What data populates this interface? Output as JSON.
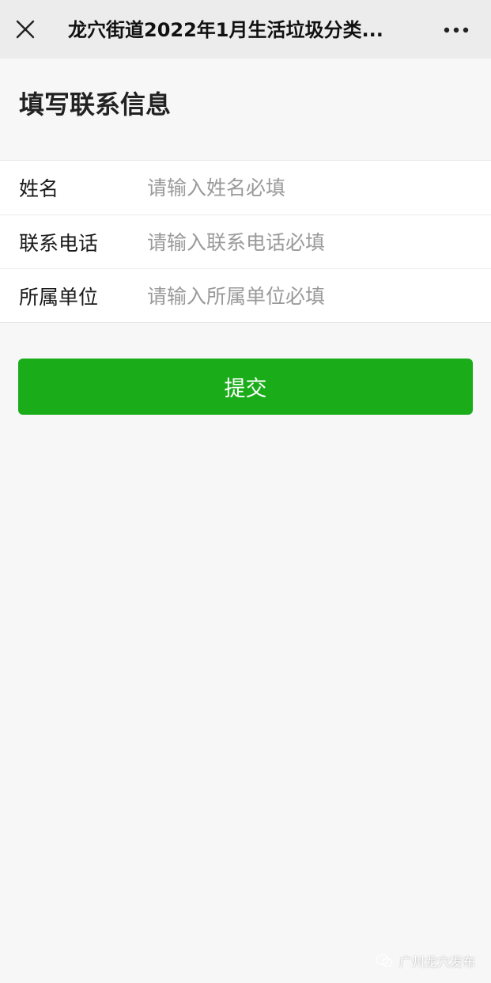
{
  "header": {
    "title": "龙穴街道2022年1月生活垃圾分类...",
    "close_icon": "close-icon",
    "more_icon": "more-icon"
  },
  "page": {
    "heading": "填写联系信息"
  },
  "form": {
    "fields": [
      {
        "label": "姓名",
        "placeholder": "请输入姓名必填",
        "value": ""
      },
      {
        "label": "联系电话",
        "placeholder": "请输入联系电话必填",
        "value": ""
      },
      {
        "label": "所属单位",
        "placeholder": "请输入所属单位必填",
        "value": ""
      }
    ],
    "submit_label": "提交"
  },
  "watermark": {
    "text": "广州龙穴发布"
  },
  "colors": {
    "accent": "#1aad19",
    "background": "#f7f7f7",
    "topbar": "#ececec",
    "placeholder": "#9a9a9a"
  }
}
